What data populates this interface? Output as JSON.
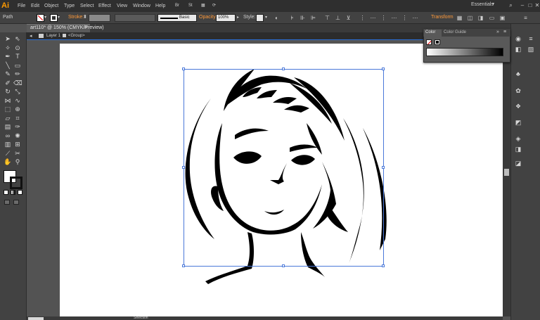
{
  "app": {
    "logo": "Ai"
  },
  "menu": [
    "File",
    "Edit",
    "Object",
    "Type",
    "Select",
    "Effect",
    "View",
    "Window",
    "Help"
  ],
  "workspace": {
    "label": "Essentials"
  },
  "control_bar": {
    "selection_type": "Path",
    "stroke_label": "Stroke:",
    "brush_style": "Basic",
    "opacity_label": "Opacity:",
    "opacity_value": "100%",
    "style_label": "Style:",
    "transform_label": "Transform"
  },
  "document_tab": {
    "title": "art110* @ 150% (CMYK/Preview)"
  },
  "breadcrumb": {
    "layer": "Layer 1",
    "group": "<Group>"
  },
  "color_panel": {
    "tab_color": "Color",
    "tab_guide": "Color Guide"
  },
  "status_bar": {
    "tool": "Selection"
  },
  "colors": {
    "accent": "#ff9a00",
    "selection": "#4a78d9",
    "chrome": "#424242"
  }
}
